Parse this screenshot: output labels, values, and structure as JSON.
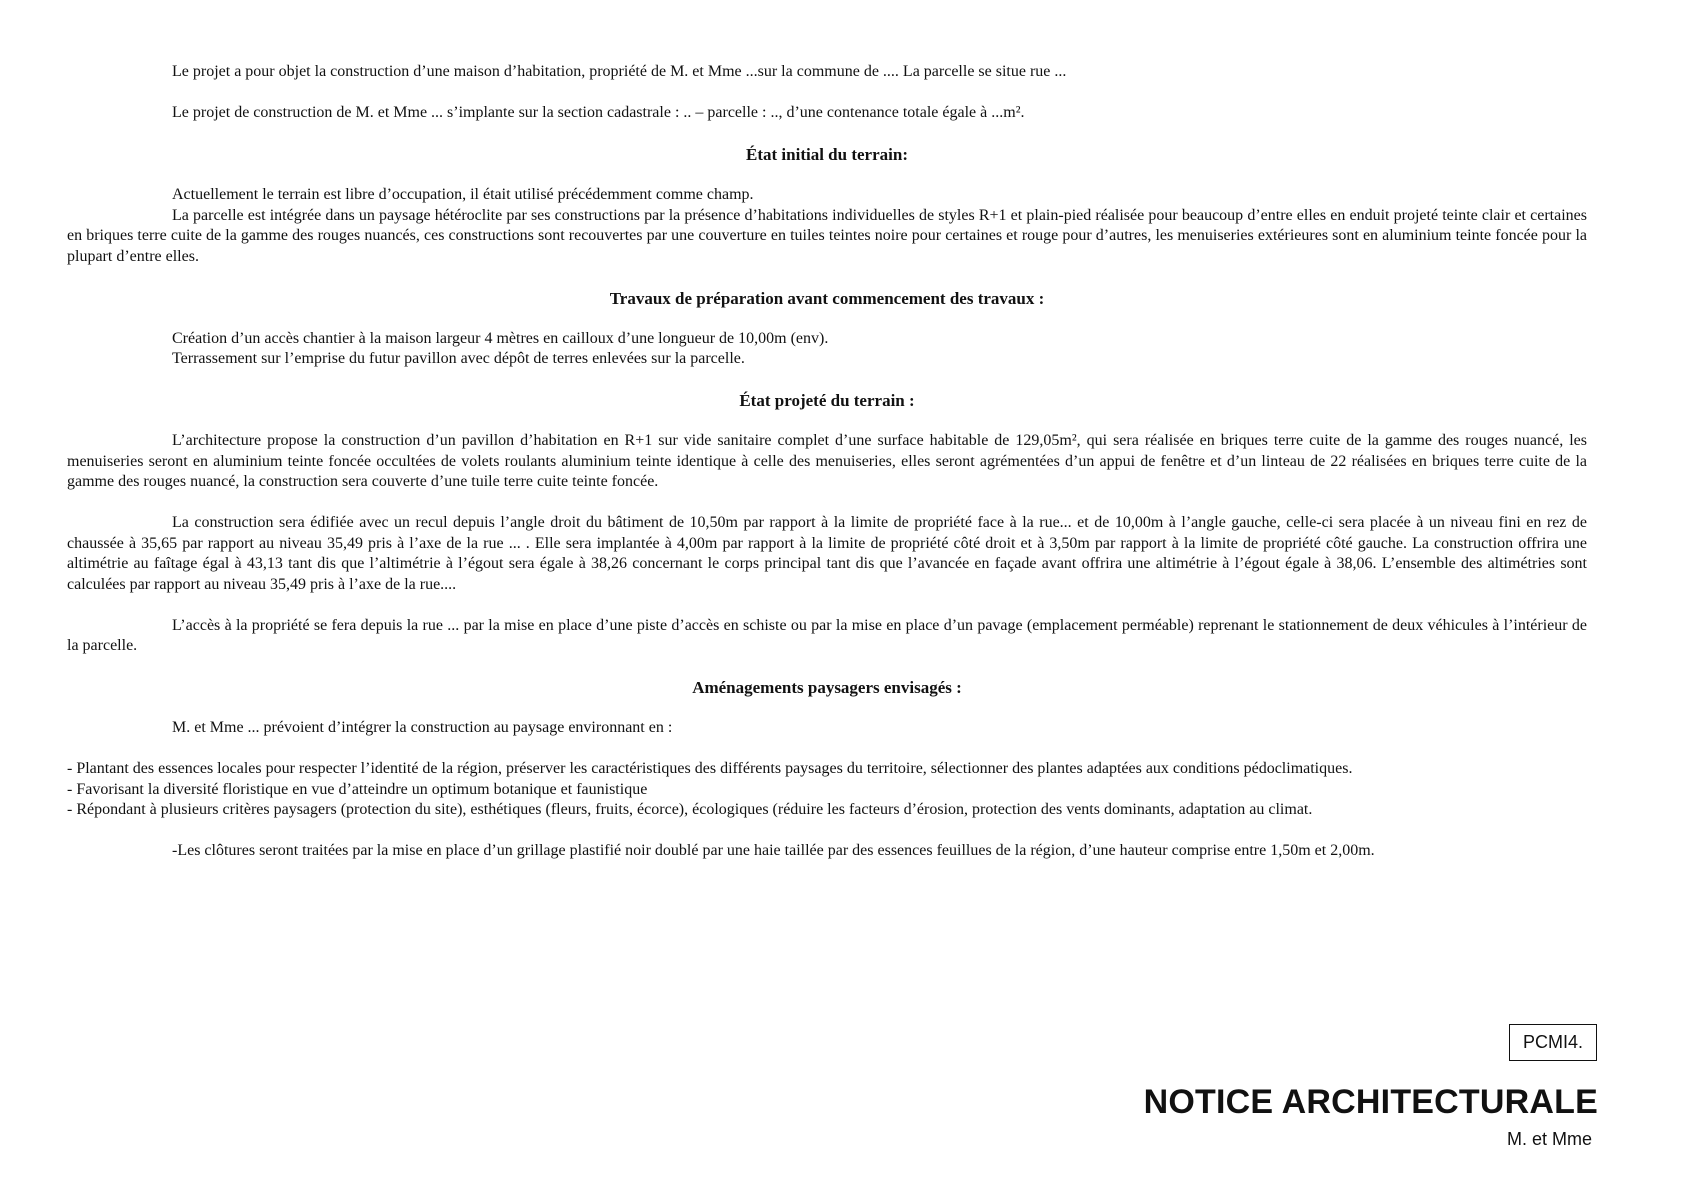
{
  "intro": {
    "p1": "Le projet a pour objet la construction d’une maison d’habitation, propriété de M. et Mme ...sur la commune de .... La parcelle se situe rue ...",
    "p2": "Le projet de construction de M. et Mme ... s’implante sur la section cadastrale : ..  – parcelle : .., d’une contenance totale égale à ...m²."
  },
  "etat_initial": {
    "heading": "État initial du terrain:",
    "line1": "Actuellement le terrain est libre d’occupation, il était utilisé précédemment comme champ.",
    "p2": "La parcelle est intégrée dans un paysage hétéroclite par ses constructions par la présence d’habitations individuelles de styles R+1 et plain-pied réalisée pour beaucoup d’entre elles en enduit projeté teinte clair et certaines en briques terre cuite de la gamme des rouges nuancés, ces constructions sont recouvertes par une couverture en tuiles teintes noire pour certaines et rouge pour d’autres, les menuiseries extérieures sont en aluminium teinte foncée pour la plupart d’entre elles."
  },
  "travaux": {
    "heading": "Travaux de préparation avant commencement des travaux :",
    "line1": "Création d’un accès chantier à la maison largeur 4 mètres en cailloux d’une longueur de 10,00m (env).",
    "line2": "Terrassement sur l’emprise du futur pavillon avec dépôt de terres enlevées sur la parcelle."
  },
  "etat_projete": {
    "heading": "État projeté du terrain :",
    "p1": "L’architecture propose la construction d’un pavillon d’habitation en R+1 sur vide sanitaire complet d’une surface habitable de 129,05m², qui sera réalisée en briques terre cuite de la gamme des rouges nuancé, les menuiseries seront en aluminium teinte foncée occultées de volets roulants aluminium teinte identique à celle des menuiseries, elles seront agrémentées d’un appui de fenêtre et d’un linteau de 22 réalisées en briques terre cuite de la gamme des rouges nuancé, la construction sera couverte d’une tuile terre cuite teinte foncée.",
    "p2": "La construction sera édifiée avec un recul depuis l’angle droit du bâtiment de 10,50m par rapport à la limite de propriété face à la rue... et de 10,00m à l’angle gauche, celle-ci sera placée à un niveau fini en rez de chaussée à 35,65 par rapport au niveau 35,49 pris à l’axe de la rue ... . Elle sera implantée à 4,00m par rapport à la limite de propriété côté droit et à 3,50m par rapport à la limite de propriété côté gauche. La construction offrira une altimétrie au faîtage égal à 43,13 tant dis que l’altimétrie à l’égout sera égale à 38,26 concernant le corps principal tant dis que l’avancée en façade avant offrira une altimétrie à l’égout égale à 38,06. L’ensemble des altimétries sont calculées par rapport au niveau 35,49 pris à l’axe de la rue....",
    "p3": "L’accès à la propriété se fera depuis la rue ... par la mise en place d’une piste d’accès en schiste ou par la mise en place d’un pavage (emplacement perméable) reprenant le stationnement de deux véhicules à l’intérieur de la parcelle."
  },
  "amenagements": {
    "heading": "Aménagements paysagers envisagés :",
    "intro": "M. et Mme ... prévoient d’intégrer la construction au paysage environnant en :",
    "bullets": [
      "- Plantant des essences locales pour respecter l’identité de la région, préserver les caractéristiques des différents paysages du territoire, sélectionner des plantes adaptées aux conditions pédoclimatiques.",
      "- Favorisant la diversité floristique en vue d’atteindre un optimum botanique et faunistique",
      "- Répondant à plusieurs critères paysagers (protection du site), esthétiques (fleurs, fruits, écorce), écologiques (réduire les facteurs d’érosion, protection des vents dominants, adaptation au climat."
    ],
    "clotures": "-Les clôtures seront traitées par la mise en place d’un grillage plastifié noir doublé par une haie taillée par des essences feuillues de la région, d’une hauteur comprise entre 1,50m et 2,00m."
  },
  "cartouche": {
    "reference": "PCMI4.",
    "title": "NOTICE ARCHITECTURALE",
    "subtitle": "M. et Mme"
  }
}
